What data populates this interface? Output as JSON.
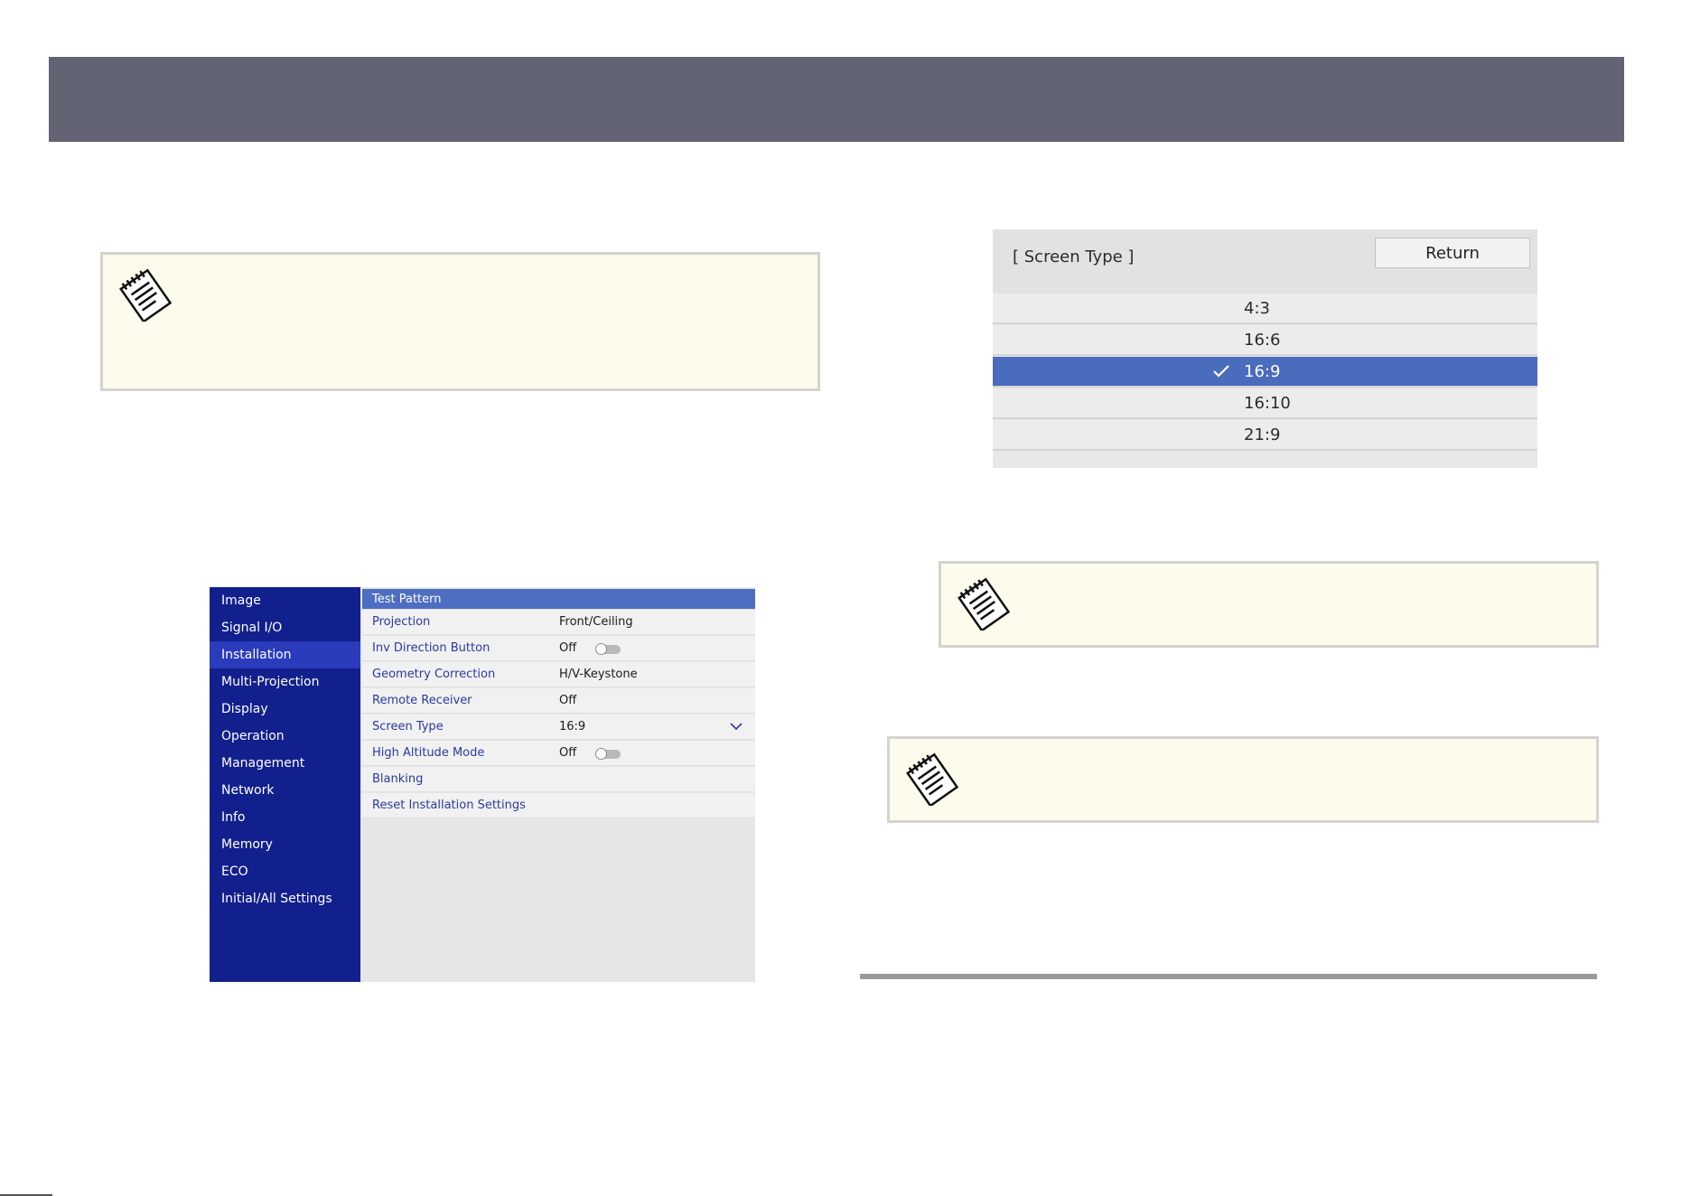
{
  "projector_menu": {
    "sidebar": [
      "Image",
      "Signal I/O",
      "Installation",
      "Multi-Projection",
      "Display",
      "Operation",
      "Management",
      "Network",
      "Info",
      "Memory",
      "ECO",
      "Initial/All Settings"
    ],
    "active_sidebar_item": "Installation",
    "rows": [
      {
        "label": "Test Pattern",
        "value": ""
      },
      {
        "label": "Projection",
        "value": "Front/Ceiling"
      },
      {
        "label": "Inv Direction Button",
        "value": "Off"
      },
      {
        "label": "Geometry Correction",
        "value": "H/V-Keystone"
      },
      {
        "label": "Remote Receiver",
        "value": "Off"
      },
      {
        "label": "Screen Type",
        "value": "16:9"
      },
      {
        "label": "High Altitude Mode",
        "value": "Off"
      },
      {
        "label": "Blanking",
        "value": ""
      },
      {
        "label": "Reset Installation Settings",
        "value": ""
      }
    ]
  },
  "screen_type_dialog": {
    "title": "[ Screen Type ]",
    "return_label": "Return",
    "options": [
      "4:3",
      "16:6",
      "16:9",
      "16:10",
      "21:9"
    ],
    "selected": "16:9"
  },
  "colors": {
    "header_bar": "#626473",
    "note_background": "#fdfbeb",
    "menu_sidebar": "#12208d",
    "highlight": "#4a6cbc"
  },
  "icons": [
    "note-pad-icon",
    "toggle-switch-icon",
    "chevron-down-icon",
    "checkmark-icon"
  ]
}
